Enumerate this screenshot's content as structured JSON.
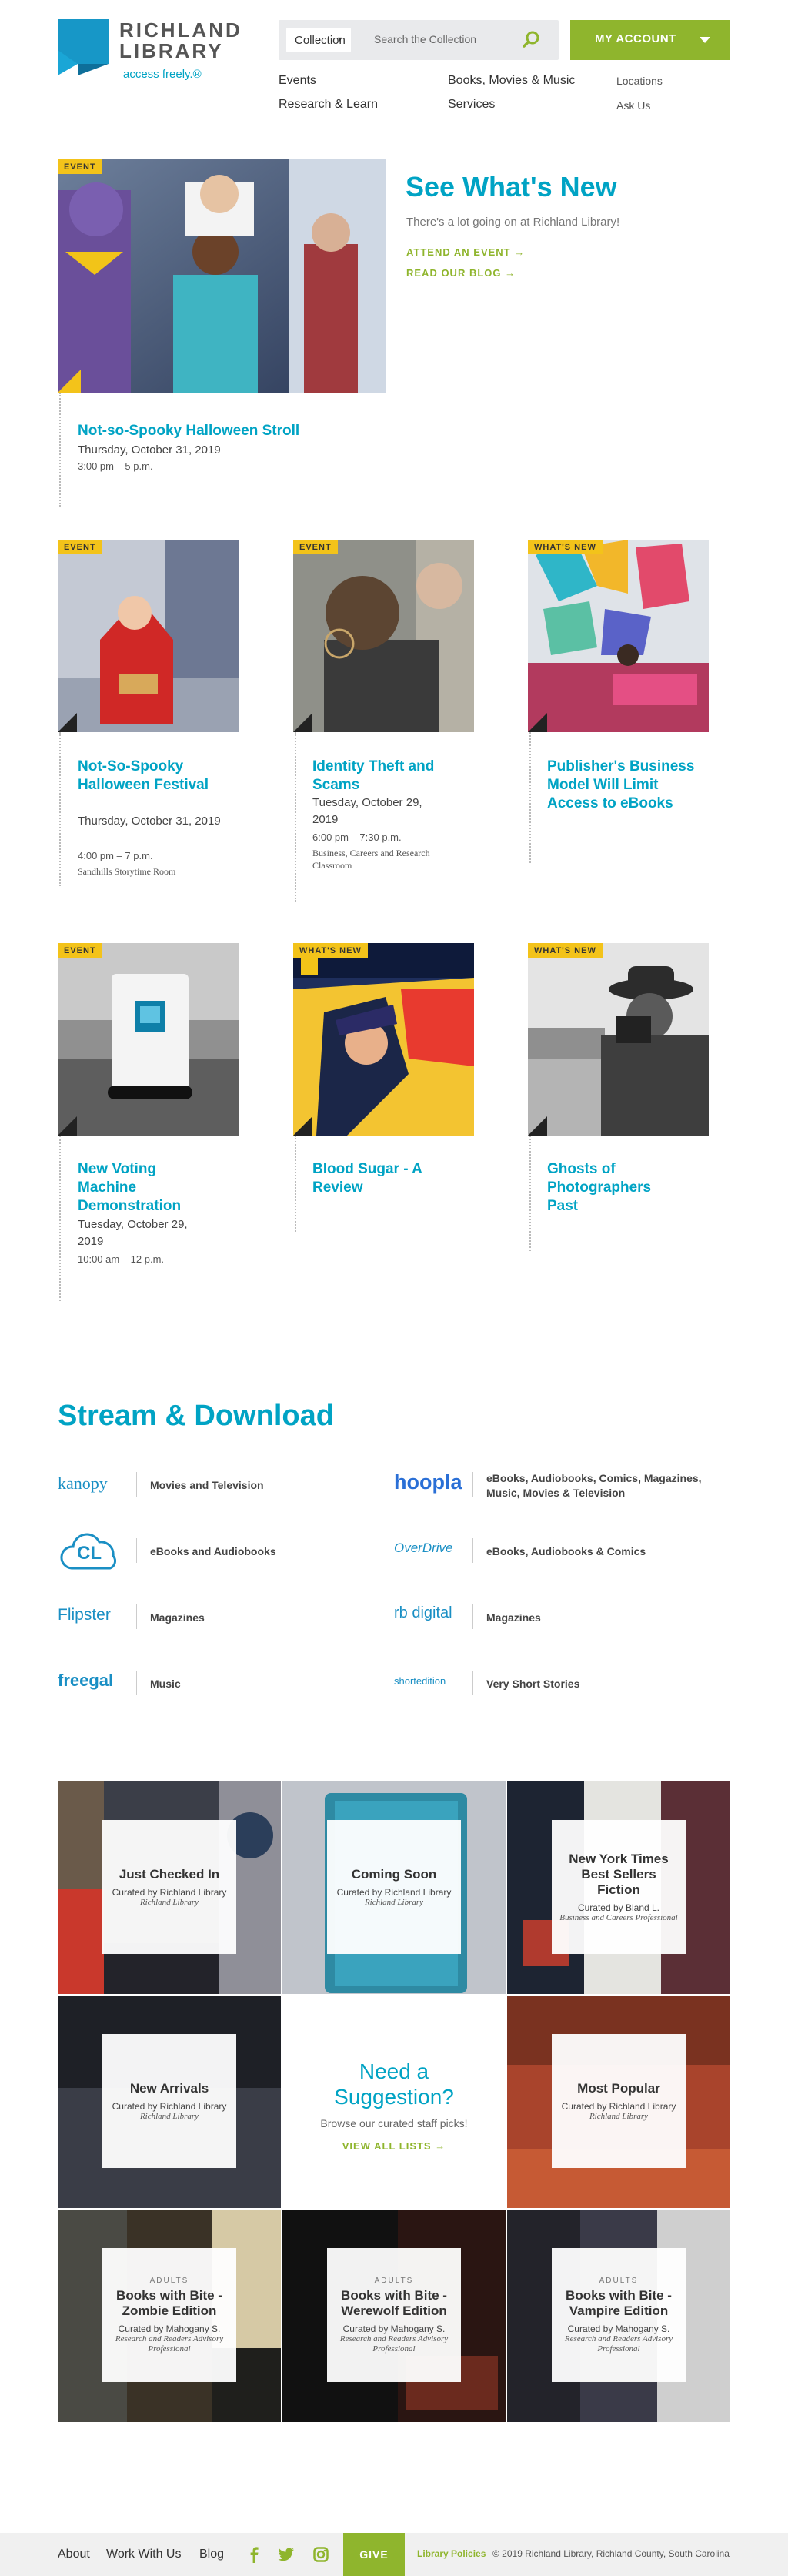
{
  "header": {
    "logo_name_line1": "RICHLAND",
    "logo_name_line2": "LIBRARY",
    "logo_tagline": "access freely.®",
    "search": {
      "collection": "Collection",
      "placeholder": "Search the Collection"
    },
    "account_label": "MY ACCOUNT",
    "nav": [
      "Events",
      "Research & Learn",
      "Books, Movies & Music",
      "Services"
    ],
    "nav_small": [
      "Locations",
      "Ask Us"
    ]
  },
  "featured": {
    "badge": "EVENT",
    "heading": "See What's New",
    "subheading": "There's a lot going on at Richland Library!",
    "links": [
      "ATTEND AN EVENT →",
      "READ OUR BLOG →"
    ],
    "title": "Not-so-Spooky Halloween Stroll",
    "date": "Thursday, October 31, 2019",
    "time": "3:00 pm – 5 p.m."
  },
  "cards": [
    {
      "badge": "EVENT",
      "title": "Not-So-Spooky Halloween Festival",
      "date": "Thursday, October 31, 2019",
      "time": "4:00 pm – 7 p.m.",
      "location": "Sandhills Storytime Room"
    },
    {
      "badge": "EVENT",
      "title": "Identity Theft and Scams",
      "date": "Tuesday, October 29, 2019",
      "time": "6:00 pm – 7:30 p.m.",
      "location": "Business, Careers and Research Classroom"
    },
    {
      "badge": "WHAT'S NEW",
      "title": "Publisher's Business Model Will Limit Access to eBooks",
      "date": "",
      "time": "",
      "location": ""
    },
    {
      "badge": "EVENT",
      "title": "New Voting Machine Demonstration",
      "date": "Tuesday, October 29, 2019",
      "time": "10:00 am – 12 p.m.",
      "location": ""
    },
    {
      "badge": "WHAT'S NEW",
      "title": "Blood Sugar - A Review",
      "date": "",
      "time": "",
      "location": ""
    },
    {
      "badge": "WHAT'S NEW",
      "title": "Ghosts of Photographers Past",
      "date": "",
      "time": "",
      "location": ""
    }
  ],
  "stream": {
    "heading": "Stream & Download",
    "items": [
      {
        "logo": "kanopy",
        "desc": "Movies and Television"
      },
      {
        "logo": "hoopla",
        "desc": "eBooks, Audiobooks, Comics, Magazines, Music, Movies & Television"
      },
      {
        "logo": "CL",
        "desc": "eBooks and Audiobooks"
      },
      {
        "logo": "OverDrive",
        "desc": "eBooks, Audiobooks & Comics"
      },
      {
        "logo": "Flipster",
        "desc": "Magazines"
      },
      {
        "logo": "rb digital",
        "desc": "Magazines"
      },
      {
        "logo": "freegal",
        "desc": "Music"
      },
      {
        "logo": "shortedition",
        "desc": "Very Short Stories"
      }
    ]
  },
  "lists": [
    {
      "category": "",
      "title": "Just Checked In",
      "curator": "Curated by Richland Library",
      "role": "Richland Library"
    },
    {
      "category": "",
      "title": "Coming Soon",
      "curator": "Curated by Richland Library",
      "role": "Richland Library"
    },
    {
      "category": "",
      "title": "New York Times Best Sellers Fiction",
      "curator": "Curated by Bland L.",
      "role": "Business and Careers Professional"
    },
    {
      "category": "",
      "title": "New Arrivals",
      "curator": "Curated by Richland Library",
      "role": "Richland Library"
    },
    {
      "category": "",
      "title": "Most Popular",
      "curator": "Curated by Richland Library",
      "role": "Richland Library"
    },
    {
      "category": "ADULTS",
      "title": "Books with Bite - Zombie Edition",
      "curator": "Curated by Mahogany S.",
      "role": "Research and Readers Advisory Professional"
    },
    {
      "category": "ADULTS",
      "title": "Books with Bite - Werewolf Edition",
      "curator": "Curated by Mahogany S.",
      "role": "Research and Readers Advisory Professional"
    },
    {
      "category": "ADULTS",
      "title": "Books with Bite - Vampire Edition",
      "curator": "Curated by Mahogany S.",
      "role": "Research and Readers Advisory Professional"
    }
  ],
  "suggestion": {
    "heading": "Need a Suggestion?",
    "text": "Browse our curated staff picks!",
    "link": "VIEW ALL LISTS →"
  },
  "footer": {
    "links": [
      "About",
      "Work With Us",
      "Blog"
    ],
    "give": "GIVE",
    "policies": "Library Policies",
    "copyright": "© 2019 Richland Library, Richland County, South Carolina"
  },
  "colors": {
    "brand_blue": "#00a3c4",
    "green": "#8fb52d",
    "badge_yellow": "#f3c31a"
  }
}
